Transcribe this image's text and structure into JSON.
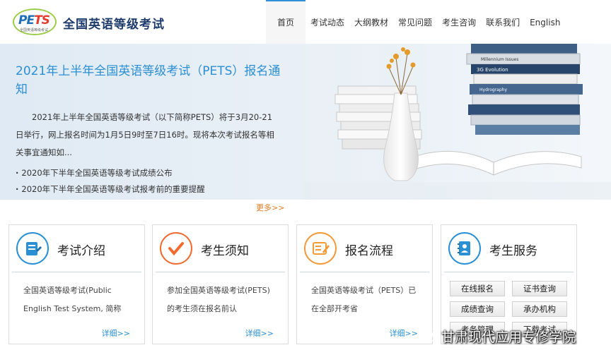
{
  "header": {
    "logo_text": "PETS",
    "logo_sub": "全国英语等级考试",
    "site_title": "全国英语等级考试"
  },
  "nav": {
    "items": [
      "首页",
      "考试动态",
      "大纲教材",
      "常见问题",
      "考生咨询",
      "联系我们",
      "English"
    ],
    "active": "首页"
  },
  "banner": {
    "title": "2021年上半年全国英语等级考试（PETS）报名通知",
    "description": "2021年上半年全国英语等级考试（以下简称PETS）将于3月20-21日举行，网上报名时间为1月5日9时至7日16时。现将本次考试报名等相关事宜通知如...",
    "links": [
      "2020年下半年全国英语等级考试成绩公布",
      "2020年下半年全国英语等级考试报考前的重要提醒"
    ],
    "more": "更多>>"
  },
  "cards": [
    {
      "title": "考试介绍",
      "icon": "notepad-pen-icon",
      "color": "#2b8fd4",
      "text": "全国英语等级考试(Public English Test System, 简称",
      "more": "详细>>"
    },
    {
      "title": "考生须知",
      "icon": "checkmark-icon",
      "color": "#f26a2e",
      "text": "参加全国英语等级考试(PETS)的考生须在报名前认",
      "more": "详细>>"
    },
    {
      "title": "报名流程",
      "icon": "document-edit-icon",
      "color": "#f39a3a",
      "text": "全国英语等级考试（PETS）已在全部开考省",
      "more": "详细>>"
    },
    {
      "title": "考生服务",
      "icon": "contact-book-icon",
      "color": "#2b8fd4",
      "buttons": [
        "在线报名",
        "证书查询",
        "成绩查询",
        "承办机构",
        "考务管理",
        "下载考试"
      ]
    }
  ],
  "watermark": "甘肃现代应用专修学院",
  "colors": {
    "accent": "#2b8fd4",
    "more": "#e07b20",
    "title": "#1d3b6b"
  }
}
